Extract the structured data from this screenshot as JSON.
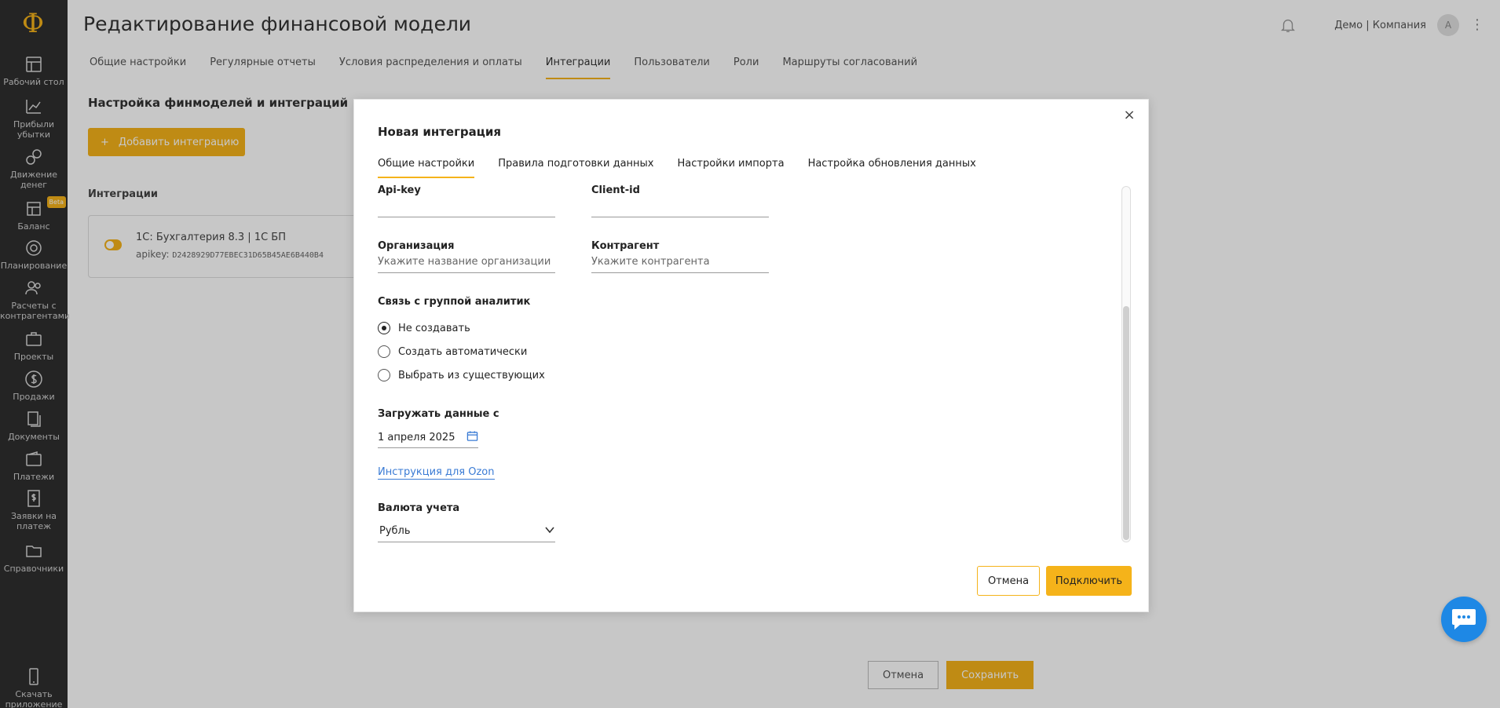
{
  "app": {
    "logo": "Ф",
    "page_title": "Редактирование финансовой модели",
    "user": "Демо | Компания",
    "avatar_letter": "А"
  },
  "sidebar": {
    "items": [
      {
        "label": "Рабочий стол",
        "icon": "desktop-icon"
      },
      {
        "label": "Прибыли убытки",
        "icon": "chart-icon"
      },
      {
        "label": "Движение денег",
        "icon": "cashflow-icon"
      },
      {
        "label": "Баланс",
        "icon": "balance-icon",
        "badge": "Beta"
      },
      {
        "label": "Планирование",
        "icon": "target-icon"
      },
      {
        "label": "Расчеты с контрагентами",
        "icon": "people-icon"
      },
      {
        "label": "Проекты",
        "icon": "briefcase-icon"
      },
      {
        "label": "Продажи",
        "icon": "dollar-icon"
      },
      {
        "label": "Документы",
        "icon": "documents-icon"
      },
      {
        "label": "Платежи",
        "icon": "wallet-icon"
      },
      {
        "label": "Заявки на платеж",
        "icon": "request-icon"
      },
      {
        "label": "Справочники",
        "icon": "folder-icon"
      },
      {
        "label": "Скачать приложение",
        "icon": "phone-icon"
      }
    ]
  },
  "tabs": [
    {
      "label": "Общие настройки"
    },
    {
      "label": "Регулярные отчеты"
    },
    {
      "label": "Условия распределения и оплаты"
    },
    {
      "label": "Интеграции",
      "active": true
    },
    {
      "label": "Пользователи"
    },
    {
      "label": "Роли"
    },
    {
      "label": "Маршруты согласований"
    }
  ],
  "content": {
    "section_title": "Настройка финмоделей и интеграций",
    "add_button": "Добавить интеграцию",
    "add_icon": "+",
    "integrations_label": "Интеграции",
    "integration": {
      "name": "1С: Бухгалтерия 8.3 | 1С БП",
      "key_label": "apikey:",
      "key_value": "D2428929D77EBEC31D65B45AE6B440B4"
    },
    "cancel": "Отмена",
    "save": "Сохранить"
  },
  "modal": {
    "title": "Новая интеграция",
    "close": "×",
    "tabs": [
      {
        "label": "Общие настройки",
        "active": true
      },
      {
        "label": "Правила подготовки данных"
      },
      {
        "label": "Настройки импорта"
      },
      {
        "label": "Настройка обновления данных"
      }
    ],
    "api_key_label": "Api-key",
    "api_key_value": "",
    "client_id_label": "Client-id",
    "client_id_value": "",
    "org_label": "Организация",
    "org_placeholder": "Укажите название организации",
    "counterparty_label": "Контрагент",
    "counterparty_placeholder": "Укажите контрагента",
    "analytics_label": "Связь с группой аналитик",
    "radio_options": [
      {
        "label": "Не создавать",
        "checked": true
      },
      {
        "label": "Создать автоматически",
        "checked": false
      },
      {
        "label": "Выбрать из существующих",
        "checked": false
      }
    ],
    "load_from_label": "Загружать данные с",
    "load_from_value": "1 апреля 2025",
    "instruction_link": "Инструкция для Ozon",
    "currency_label": "Валюта учета",
    "currency_value": "Рубль",
    "cancel_button": "Отмена",
    "connect_button": "Подключить"
  },
  "colors": {
    "accent": "#f5b31a",
    "link": "#3a7bd5",
    "sidebar": "#2f2f2f",
    "chat": "#1e88e5"
  }
}
